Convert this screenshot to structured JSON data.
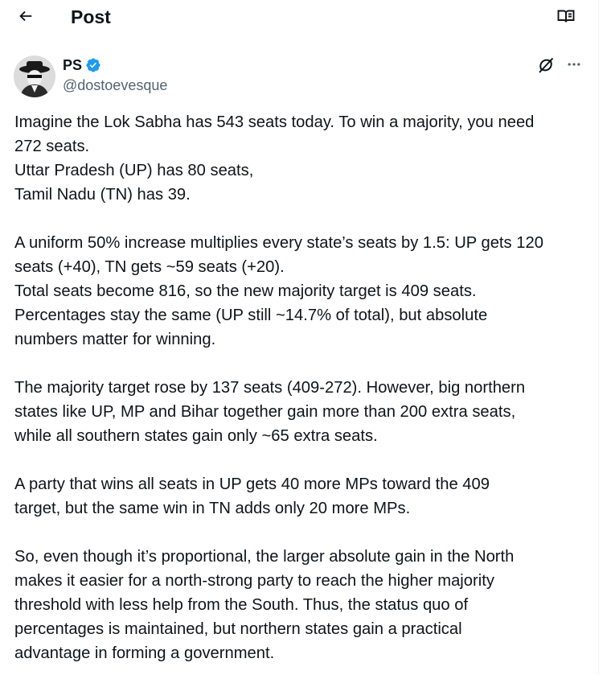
{
  "header": {
    "title": "Post",
    "back_icon": "arrow-left-icon",
    "reader_icon": "open-book-icon"
  },
  "author": {
    "name": "PS",
    "handle": "@dostoevesque",
    "verified": true,
    "verified_color": "#1d9bf0",
    "avatar_icon": "avatar-image"
  },
  "actions": {
    "grok_icon": "grok-icon",
    "more_icon": "more-horizontal-icon"
  },
  "post": {
    "paragraphs": [
      {
        "lines": [
          "Imagine the Lok Sabha has 543 seats today. To win a majority, you need",
          "272 seats.",
          "Uttar Pradesh (UP) has 80 seats,",
          "Tamil Nadu (TN) has 39."
        ]
      },
      {
        "lines": [
          "A uniform 50% increase multiplies every state’s seats by 1.5: UP gets 120",
          "seats (+40), TN gets ~59 seats (+20).",
          "Total seats become 816, so the new majority target is 409 seats.",
          "Percentages stay the same (UP still ~14.7% of total), but absolute",
          "numbers matter for winning."
        ]
      },
      {
        "lines": [
          "The majority target rose by 137 seats (409-272). However, big northern",
          "states like UP, MP and Bihar together gain more than 200 extra seats,",
          "while all southern states gain only ~65 extra seats."
        ]
      },
      {
        "lines": [
          "A party that wins all seats in UP gets 40 more MPs toward the 409",
          "target, but the same win in TN adds only 20 more MPs."
        ]
      },
      {
        "lines": [
          "So, even though it’s proportional, the larger absolute gain in the North",
          "makes it easier for a north-strong party to reach the higher majority",
          "threshold with less help from the South. Thus, the status quo of",
          "percentages is maintained, but northern states gain a practical",
          "advantage in forming a government."
        ]
      }
    ]
  }
}
